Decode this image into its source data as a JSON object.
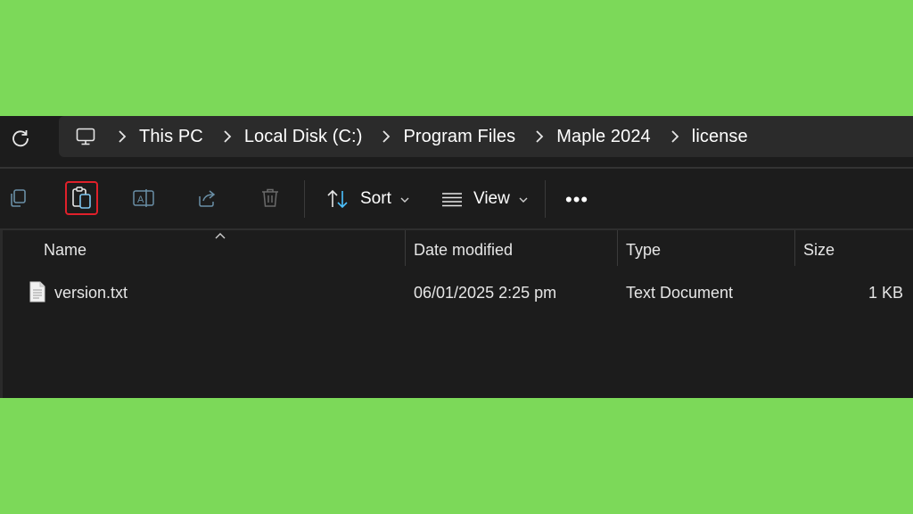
{
  "breadcrumb": {
    "items": [
      "This PC",
      "Local Disk (C:)",
      "Program Files",
      "Maple 2024",
      "license"
    ]
  },
  "toolbar": {
    "sort_label": "Sort",
    "view_label": "View",
    "more_label": "•••"
  },
  "columns": {
    "name": "Name",
    "date": "Date modified",
    "type": "Type",
    "size": "Size"
  },
  "files": [
    {
      "name": "version.txt",
      "date": "06/01/2025 2:25 pm",
      "type": "Text Document",
      "size": "1 KB"
    }
  ],
  "colors": {
    "background": "#7cd959",
    "window": "#1c1c1c",
    "address_box": "#2b2b2b",
    "highlight": "#e0202a",
    "accent_blue": "#4cc2ff"
  },
  "icons": [
    "refresh-icon",
    "computer-icon",
    "chevron-right-icon",
    "copy-icon",
    "paste-icon",
    "rename-icon",
    "share-icon",
    "delete-icon",
    "sort-icon",
    "view-icon",
    "more-icon",
    "text-file-icon",
    "sort-caret-icon"
  ]
}
